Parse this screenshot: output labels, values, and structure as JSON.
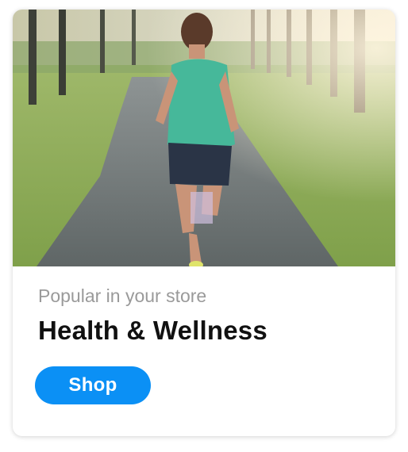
{
  "card": {
    "subtitle": "Popular in your store",
    "title": "Health & Wellness",
    "shop_label": "Shop"
  },
  "colors": {
    "button": "#0b90f5",
    "subtitle": "#9a9a9a",
    "title": "#111111"
  }
}
